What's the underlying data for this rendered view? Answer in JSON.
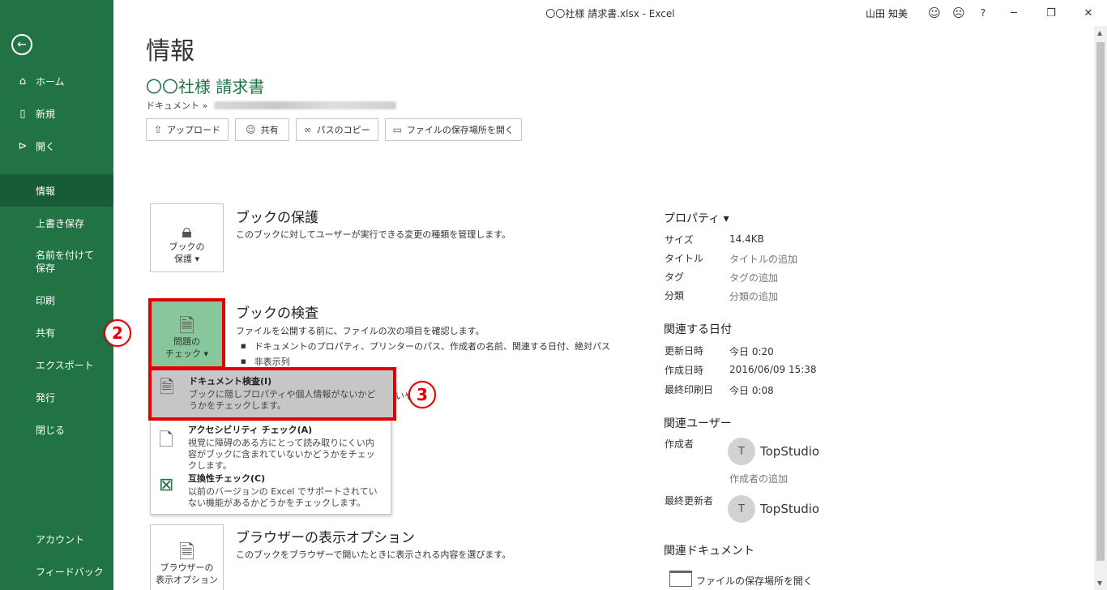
{
  "window": {
    "title": "〇〇社様 請求書.xlsx  -  Excel",
    "user": "山田 知美",
    "icons": [
      "smile-icon",
      "frown-icon",
      "help-icon",
      "minimize-icon",
      "restore-icon",
      "close-icon"
    ],
    "help_glyph": "?"
  },
  "sidebar": {
    "background": "#217346",
    "top_items": [
      {
        "label": "ホーム",
        "icon": "home-icon"
      },
      {
        "label": "新規",
        "icon": "new-doc-icon"
      },
      {
        "label": "開く",
        "icon": "folder-open-icon"
      }
    ],
    "items": [
      {
        "label": "情報",
        "active": true
      },
      {
        "label": "上書き保存"
      },
      {
        "label": "名前を付けて保存"
      },
      {
        "label": "印刷"
      },
      {
        "label": "共有"
      },
      {
        "label": "エクスポート"
      },
      {
        "label": "発行"
      },
      {
        "label": "閉じる"
      }
    ],
    "bottom_items": [
      {
        "label": "アカウント"
      },
      {
        "label": "フィードバック"
      }
    ]
  },
  "main": {
    "page_title": "情報",
    "doc_title": "〇〇社様 請求書",
    "breadcrumb": "ドキュメント »",
    "actions": [
      {
        "label": "アップロード",
        "icon": "upload-icon"
      },
      {
        "label": "共有",
        "icon": "share-icon"
      },
      {
        "label": "パスのコピー",
        "icon": "link-icon"
      },
      {
        "label": "ファイルの保存場所を開く",
        "icon": "folder-icon"
      }
    ],
    "protect": {
      "button_line1": "ブックの",
      "button_line2": "保護 ▾",
      "heading": "ブックの保護",
      "desc": "このブックに対してユーザーが実行できる変更の種類を管理します。"
    },
    "inspect": {
      "button_line1": "問題の",
      "button_line2": "チェック ▾",
      "heading": "ブックの検査",
      "desc": "ファイルを公開する前に、ファイルの次の項目を確認します。",
      "bullets": [
        "ドキュメントのプロパティ、プリンターのパス、作成者の名前、関連する日付、絶対パス",
        "非表示列"
      ],
      "partial_hidden_text": "いや"
    },
    "menu": [
      {
        "title": "ドキュメント検査(I)",
        "desc": "ブックに隠しプロパティや個人情報がないかどうかをチェックします。",
        "icon": "document-inspect-icon",
        "highlighted": true
      },
      {
        "title": "アクセシビリティ チェック(A)",
        "desc": "視覚に障碍のある方にとって読み取りにくい内容がブックに含まれていないかどうかをチェックします。",
        "icon": "accessibility-icon"
      },
      {
        "title": "互換性チェック(C)",
        "desc": "以前のバージョンの Excel でサポートされていない機能があるかどうかをチェックします。",
        "icon": "compatibility-icon"
      }
    ],
    "browser": {
      "button_line1": "ブラウザーの",
      "button_line2": "表示オプション",
      "heading": "ブラウザーの表示オプション",
      "desc": "このブックをブラウザーで開いたときに表示される内容を選びます。"
    },
    "steps": [
      "2",
      "3"
    ]
  },
  "properties": {
    "heading": "プロパティ ▾",
    "rows": [
      {
        "label": "サイズ",
        "value": "14.4KB",
        "muted": false
      },
      {
        "label": "タイトル",
        "value": "タイトルの追加",
        "muted": true
      },
      {
        "label": "タグ",
        "value": "タグの追加",
        "muted": true
      },
      {
        "label": "分類",
        "value": "分類の追加",
        "muted": true
      }
    ],
    "dates_heading": "関連する日付",
    "dates": [
      {
        "label": "更新日時",
        "value": "今日 0:20"
      },
      {
        "label": "作成日時",
        "value": "2016/06/09 15:38"
      },
      {
        "label": "最終印刷日",
        "value": "今日 0:08"
      }
    ],
    "users_heading": "関連ユーザー",
    "author_label": "作成者",
    "author_initial": "T",
    "author_name": "TopStudio",
    "add_author": "作成者の追加",
    "last_modified_label": "最終更新者",
    "last_modified_initial": "T",
    "last_modified_name": "TopStudio",
    "docs_heading": "関連ドキュメント",
    "open_location": "ファイルの保存場所を開く"
  }
}
